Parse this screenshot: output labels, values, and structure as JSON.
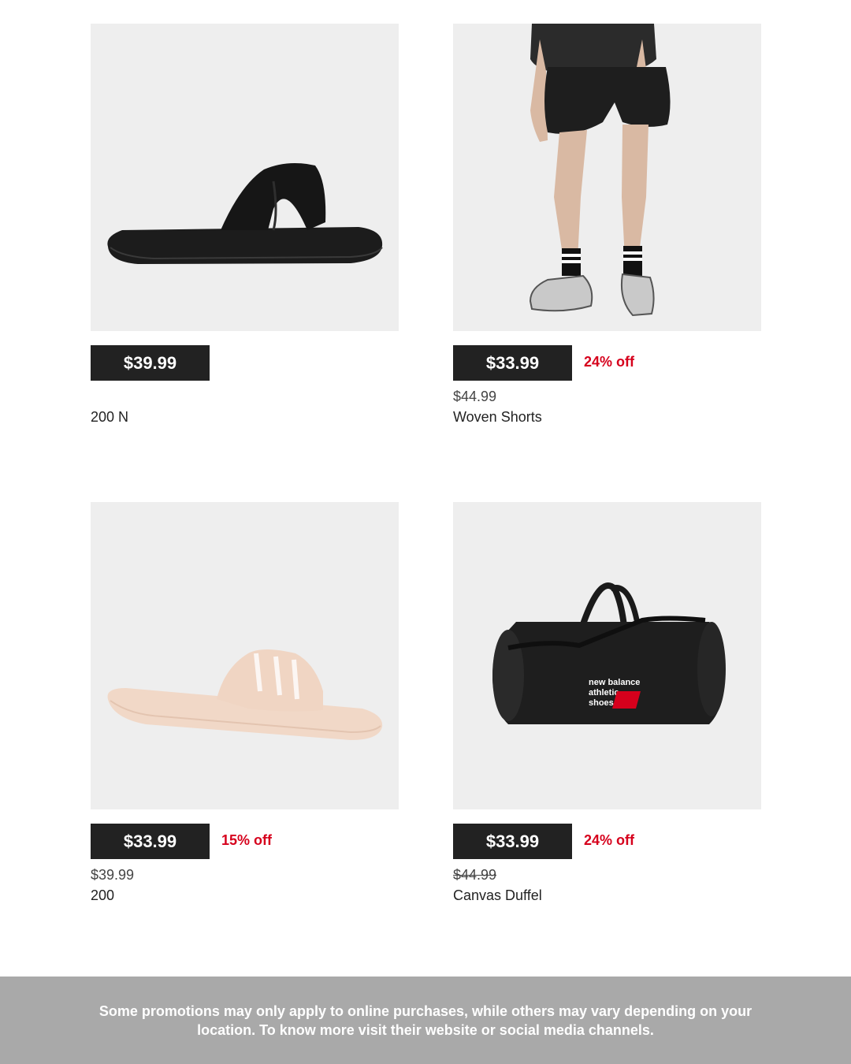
{
  "products": [
    {
      "price": "$39.99",
      "discount": "",
      "original_price": "",
      "name": "200 N",
      "icon": "black-slide-sandal"
    },
    {
      "price": "$33.99",
      "discount": "24% off",
      "original_price": "$44.99",
      "name": "Woven Shorts",
      "icon": "model-in-woven-shorts"
    },
    {
      "price": "$33.99",
      "discount": "15% off",
      "original_price": "$39.99",
      "name": "200",
      "icon": "pink-slide-sandal"
    },
    {
      "price": "$33.99",
      "discount": "24% off",
      "original_price": "$44.99",
      "name": "Canvas Duffel",
      "icon": "duffel-bag"
    }
  ],
  "duffel_logo_lines": [
    "new balance",
    "athletic",
    "shoes"
  ],
  "footer": {
    "text": "Some promotions may only apply to online purchases, while others may vary depending on your location. To know more visit their website or social media channels."
  },
  "colors": {
    "price_box": "#222222",
    "discount": "#d6001c",
    "image_bg": "#eeeeee",
    "footer_bg": "#a9a9a9"
  }
}
